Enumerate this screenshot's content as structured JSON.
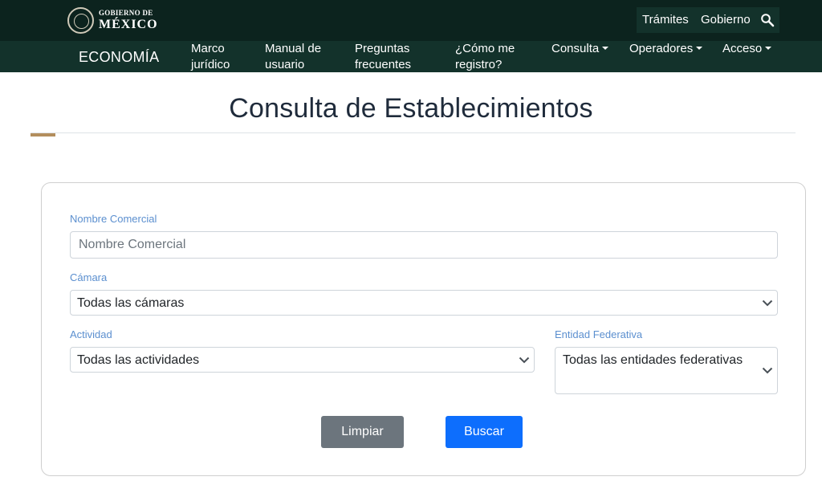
{
  "header": {
    "logo_line1": "GOBIERNO DE",
    "logo_line2": "MÉXICO",
    "links": [
      "Trámites",
      "Gobierno"
    ]
  },
  "navbar": {
    "brand": "ECONOMÍA",
    "items": [
      {
        "line1": "Marco",
        "line2": "jurídico"
      },
      {
        "line1": "Manual de",
        "line2": "usuario"
      },
      {
        "line1": "Preguntas",
        "line2": "frecuentes"
      },
      {
        "line1": "¿Cómo me",
        "line2": "registro?"
      },
      {
        "label": "Consulta"
      },
      {
        "label": "Operadores"
      },
      {
        "label": "Acceso"
      }
    ]
  },
  "page": {
    "title": "Consulta de Establecimientos"
  },
  "form": {
    "nombre_label": "Nombre Comercial",
    "nombre_placeholder": "Nombre Comercial",
    "camara_label": "Cámara",
    "camara_value": "Todas las cámaras",
    "actividad_label": "Actividad",
    "actividad_value": "Todas las actividades",
    "entidad_label": "Entidad Federativa",
    "entidad_value": "Todas las entidades federativas",
    "clear_label": "Limpiar",
    "search_label": "Buscar"
  },
  "colors": {
    "topbar": "#0c231e",
    "navbar": "#13322b",
    "accent": "#b38e5d",
    "primary": "#0d6efd",
    "secondary": "#6c757d",
    "label": "#5b8fcf"
  },
  "icons": {
    "search": "search-icon",
    "chevron": "chevron-down-icon",
    "seal": "seal-icon"
  }
}
